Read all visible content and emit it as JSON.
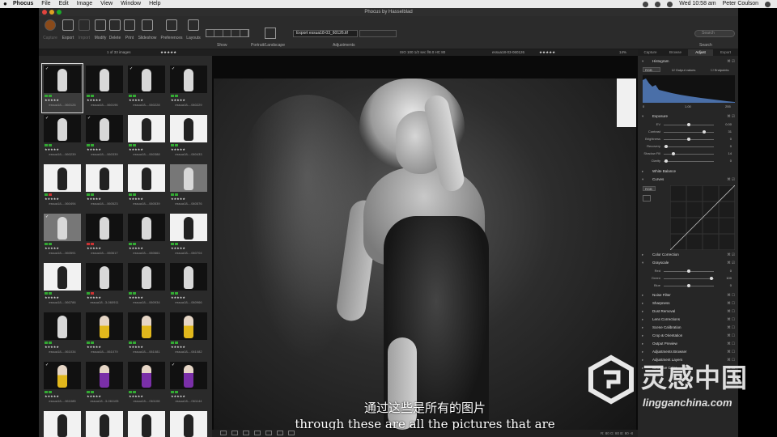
{
  "menubar": {
    "app_name": "Phocus",
    "items": [
      "File",
      "Edit",
      "Image",
      "View",
      "Window",
      "Help"
    ],
    "clock": "Wed 10:58 am",
    "user": "Peter Coulson"
  },
  "window": {
    "title": "Phocus by Hasselblad"
  },
  "toolbar": {
    "buttons": [
      "Capture",
      "Export",
      "Import",
      "Modify",
      "Delete",
      "Print",
      "Slideshow",
      "Preferences",
      "Layouts"
    ],
    "show_label": "Show",
    "portrait_label": "Portrait/Landscape",
    "export_field": "Export essua18-03_60126.tif",
    "adjustments_label": "Adjustments",
    "search_placeholder": "Search",
    "search_label": "Search"
  },
  "infobar": {
    "count": "1 of 33 images",
    "exposure": "ISO 100  1/2 sec  f/8.0  HC 80",
    "filename": "essua18-03-060126",
    "stars": "★★★★★",
    "zoom": "14%"
  },
  "thumbnails": [
    {
      "name": "essua18-...060126",
      "tone": "dark",
      "fig": "grey",
      "flags": "gg",
      "stars": "★★★★★",
      "check": "✓"
    },
    {
      "name": "essua18-...060196",
      "tone": "dark",
      "fig": "grey",
      "flags": "gg",
      "stars": "★★★★★",
      "check": ""
    },
    {
      "name": "essua18-...060228",
      "tone": "dark",
      "fig": "grey",
      "flags": "gg",
      "stars": "★★★★★",
      "check": "✓"
    },
    {
      "name": "essua18-...060229",
      "tone": "dark",
      "fig": "grey",
      "flags": "gg",
      "stars": "★★★★★",
      "check": "✓"
    },
    {
      "name": "essua18-...060239",
      "tone": "dark",
      "fig": "grey",
      "flags": "gg",
      "stars": "★★★★★",
      "check": "✓"
    },
    {
      "name": "essua18-...060339",
      "tone": "dark",
      "fig": "grey",
      "flags": "gg",
      "stars": "★★★★★",
      "check": "✓"
    },
    {
      "name": "essua18-...060388",
      "tone": "light",
      "fig": "grey",
      "flags": "gg",
      "stars": "★★★★★",
      "check": ""
    },
    {
      "name": "essua18-...060433",
      "tone": "light",
      "fig": "grey",
      "flags": "gg",
      "stars": "★★★★★",
      "check": ""
    },
    {
      "name": "essua18-...060494",
      "tone": "light",
      "fig": "grey",
      "flags": "gr",
      "stars": "★★★★★",
      "check": ""
    },
    {
      "name": "essua18-...060523",
      "tone": "light",
      "fig": "grey",
      "flags": "gg",
      "stars": "★★★★★",
      "check": ""
    },
    {
      "name": "essua18-...060539",
      "tone": "light",
      "fig": "grey",
      "flags": "gg",
      "stars": "★★★★★",
      "check": ""
    },
    {
      "name": "essua18-...060576",
      "tone": "grey",
      "fig": "grey",
      "flags": "gg",
      "stars": "★★★★★",
      "check": ""
    },
    {
      "name": "essua18-...060591",
      "tone": "grey",
      "fig": "grey",
      "flags": "gg",
      "stars": "★★★★★",
      "check": "✓"
    },
    {
      "name": "essua18-...060617",
      "tone": "dark",
      "fig": "grey",
      "flags": "rr",
      "stars": "★★★★★",
      "check": ""
    },
    {
      "name": "essua18-...060661",
      "tone": "dark",
      "fig": "grey",
      "flags": "gg",
      "stars": "★★★★★",
      "check": ""
    },
    {
      "name": "essua18-...060704",
      "tone": "light",
      "fig": "grey",
      "flags": "gg",
      "stars": "★★★★★",
      "check": ""
    },
    {
      "name": "essua18-...060786",
      "tone": "light",
      "fig": "grey",
      "flags": "gg",
      "stars": "★★★★★",
      "check": ""
    },
    {
      "name": "essua18...3-060911",
      "tone": "dark",
      "fig": "grey",
      "flags": "gr",
      "stars": "★★★★★",
      "check": ""
    },
    {
      "name": "essua18-...060934",
      "tone": "dark",
      "fig": "grey",
      "flags": "gg",
      "stars": "★★★★★",
      "check": ""
    },
    {
      "name": "essua18-...060966",
      "tone": "dark",
      "fig": "grey",
      "flags": "gg",
      "stars": "★★★★★",
      "check": ""
    },
    {
      "name": "essua18-...061034",
      "tone": "dark",
      "fig": "grey",
      "flags": "gg",
      "stars": "★★★★★",
      "check": ""
    },
    {
      "name": "essua18-...061079",
      "tone": "dark",
      "fig": "yellow",
      "flags": "gg",
      "stars": "★★★★★",
      "check": ""
    },
    {
      "name": "essua18-...061081",
      "tone": "dark",
      "fig": "yellow",
      "flags": "gg",
      "stars": "★★★★★",
      "check": ""
    },
    {
      "name": "essua18-...061082",
      "tone": "dark",
      "fig": "yellow",
      "flags": "gg",
      "stars": "★★★★★",
      "check": ""
    },
    {
      "name": "essua18-...061085",
      "tone": "dark",
      "fig": "yellow",
      "flags": "gg",
      "stars": "★★★★★",
      "check": "✓"
    },
    {
      "name": "essua18...3-061105",
      "tone": "dark",
      "fig": "purple",
      "flags": "gg",
      "stars": "★★★★★",
      "check": ""
    },
    {
      "name": "essua18-...061108",
      "tone": "dark",
      "fig": "purple",
      "flags": "gg",
      "stars": "★★★★★",
      "check": ""
    },
    {
      "name": "essua18-...061144",
      "tone": "dark",
      "fig": "purple",
      "flags": "gg",
      "stars": "★★★★★",
      "check": "✓"
    },
    {
      "name": "essua18...3-061179",
      "tone": "light",
      "fig": "grey",
      "flags": "gg",
      "stars": "★★★★★",
      "check": "✓"
    },
    {
      "name": "essua18-...061184",
      "tone": "light",
      "fig": "grey",
      "flags": "gg",
      "stars": "★★★★★",
      "check": ""
    },
    {
      "name": "essua18-...061271",
      "tone": "light",
      "fig": "grey",
      "flags": "gg",
      "stars": "★★★★★",
      "check": ""
    },
    {
      "name": "essua18-...061273",
      "tone": "light",
      "fig": "grey",
      "flags": "gg",
      "stars": "★★★★★",
      "check": ""
    }
  ],
  "subtitles": {
    "chinese": "通过这些是所有的图片",
    "english": "through these are all the pictures that are"
  },
  "viewer_bar": {
    "readout": "R: 80  G: 80  B: 80  -8"
  },
  "panel": {
    "tabs": [
      "Capture",
      "Browse",
      "Adjust",
      "Export"
    ],
    "active_tab": "Adjust",
    "histogram": {
      "title": "Histogram",
      "channel": "RGB",
      "output_values": "Output values",
      "endpoints": "Endpoints",
      "ticks": [
        "0",
        "1.00",
        "255"
      ]
    },
    "exposure": {
      "title": "Exposure",
      "sliders": [
        {
          "label": "EV",
          "value": "0.00",
          "pos": 0.5
        },
        {
          "label": "Contrast",
          "value": "31",
          "pos": 0.8
        },
        {
          "label": "Brightness",
          "value": "0",
          "pos": 0.5
        },
        {
          "label": "Recovery",
          "value": "0",
          "pos": 0.05
        },
        {
          "label": "Shadow Fill",
          "value": "14",
          "pos": 0.2
        },
        {
          "label": "Clarity",
          "value": "0",
          "pos": 0.05
        }
      ]
    },
    "white_balance": "White Balance",
    "curves": {
      "title": "Curves",
      "channel": "RGB"
    },
    "color_correction": "Color Correction",
    "grayscale": {
      "title": "Grayscale",
      "sliders": [
        {
          "label": "Red",
          "value": "0",
          "pos": 0.5
        },
        {
          "label": "Green",
          "value": "100",
          "pos": 0.95
        },
        {
          "label": "Blue",
          "value": "0",
          "pos": 0.5
        }
      ]
    },
    "tools": [
      "Noise Filter",
      "Sharpness",
      "Dust Removal",
      "Lens Corrections",
      "Scene Calibration",
      "Crop & Orientation",
      "Output Preview",
      "Adjustments Browser",
      "Adjustment Layers",
      "Selective Color"
    ]
  },
  "watermark": {
    "brand": "灵感中国",
    "url": "lingganchina.com"
  }
}
